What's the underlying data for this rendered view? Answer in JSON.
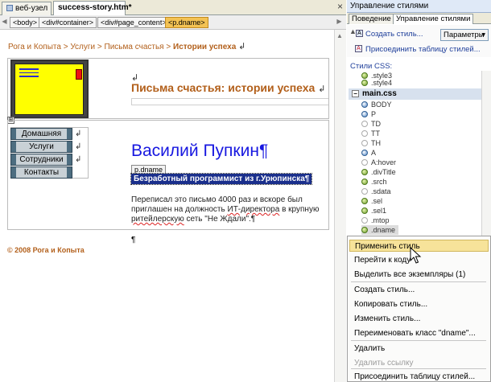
{
  "editor": {
    "tabs": [
      {
        "label": "веб-узел"
      },
      {
        "label": "success-story.htm*",
        "close": "×"
      }
    ],
    "tag_path": [
      "<body>",
      "<div#container>",
      "<div#page_content>",
      "<p.dname>"
    ],
    "breadcrumb": {
      "items": [
        "Рога и Копыта",
        "Услуги",
        "Письма счастья"
      ],
      "separator": ">",
      "current": "Истории успеха"
    },
    "pilcrow": "¶",
    "return_mark": "↲",
    "site_title": "Письма счастья: истории успеха",
    "nav": [
      "Домашняя",
      "Услуги",
      "Сотрудники",
      "Контакты"
    ],
    "person_name": "Василий Пупкин",
    "tag_label": "p.dname",
    "subtitle": "Безработный программист из г.Урюпинска",
    "body_parts": [
      "Переписал это письмо 4000 раз и вскоре был приглашен на должность ",
      "ИТ-директора",
      " в крупную ",
      "ритейлерскую",
      " сеть \"Не Ждали\"."
    ],
    "copyright": "© 2008 Рога и Копыта"
  },
  "panel": {
    "title": "Управление стилями",
    "tabs": [
      "Поведение",
      "Управление стилями"
    ],
    "create_style": "Создать стиль...",
    "attach_css": "Присоединить таблицу стилей...",
    "params_label": "Параметры",
    "css_styles_label": "Стили CSS:",
    "tree_top": [
      ".style3",
      ".style4"
    ],
    "main_css_label": "main.css",
    "tree": [
      {
        "label": "BODY",
        "kind": "b"
      },
      {
        "label": "P",
        "kind": "b"
      },
      {
        "label": "TD",
        "kind": "h"
      },
      {
        "label": "TT",
        "kind": "h"
      },
      {
        "label": "TH",
        "kind": "h"
      },
      {
        "label": "A",
        "kind": "b"
      },
      {
        "label": "A:hover",
        "kind": "h"
      },
      {
        "label": ".divTitle",
        "kind": "g"
      },
      {
        "label": ".srch",
        "kind": "g"
      },
      {
        "label": ".sdata",
        "kind": "h"
      },
      {
        "label": ".sel",
        "kind": "g"
      },
      {
        "label": ".sel1",
        "kind": "g"
      },
      {
        "label": ".mtop",
        "kind": "h"
      },
      {
        "label": ".dname",
        "kind": "g"
      }
    ]
  },
  "context_menu": {
    "items": [
      {
        "label": "Применить стиль",
        "state": "highlighted"
      },
      {
        "label": "Перейти к коду",
        "state": "normal"
      },
      {
        "label": "Выделить все экземпляры (1)",
        "state": "normal"
      },
      {
        "label": "Создать стиль...",
        "state": "normal"
      },
      {
        "label": "Копировать стиль...",
        "state": "normal"
      },
      {
        "label": "Изменить стиль...",
        "state": "normal"
      },
      {
        "label": "Переименовать класс \"dname\"...",
        "state": "normal"
      },
      {
        "label": "Удалить",
        "state": "normal"
      },
      {
        "label": "Удалить ссылку",
        "state": "disabled"
      },
      {
        "label": "Присоединить таблицу стилей...",
        "state": "normal"
      }
    ]
  }
}
